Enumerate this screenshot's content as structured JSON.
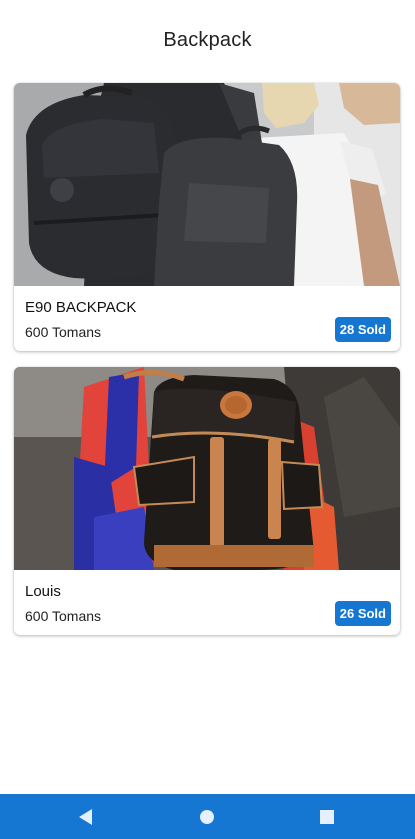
{
  "header": {
    "title": "Backpack"
  },
  "products": [
    {
      "title": "E90 BACKPACK",
      "price": "600 Tomans",
      "sold": "28 Sold"
    },
    {
      "title": "Louis",
      "price": "600 Tomans",
      "sold": "26 Sold"
    }
  ],
  "colors": {
    "accent": "#1577d2",
    "nav_icon": "#e6efff"
  },
  "nav": {
    "icons": [
      "back-icon",
      "home-icon",
      "recent-apps-icon"
    ]
  }
}
